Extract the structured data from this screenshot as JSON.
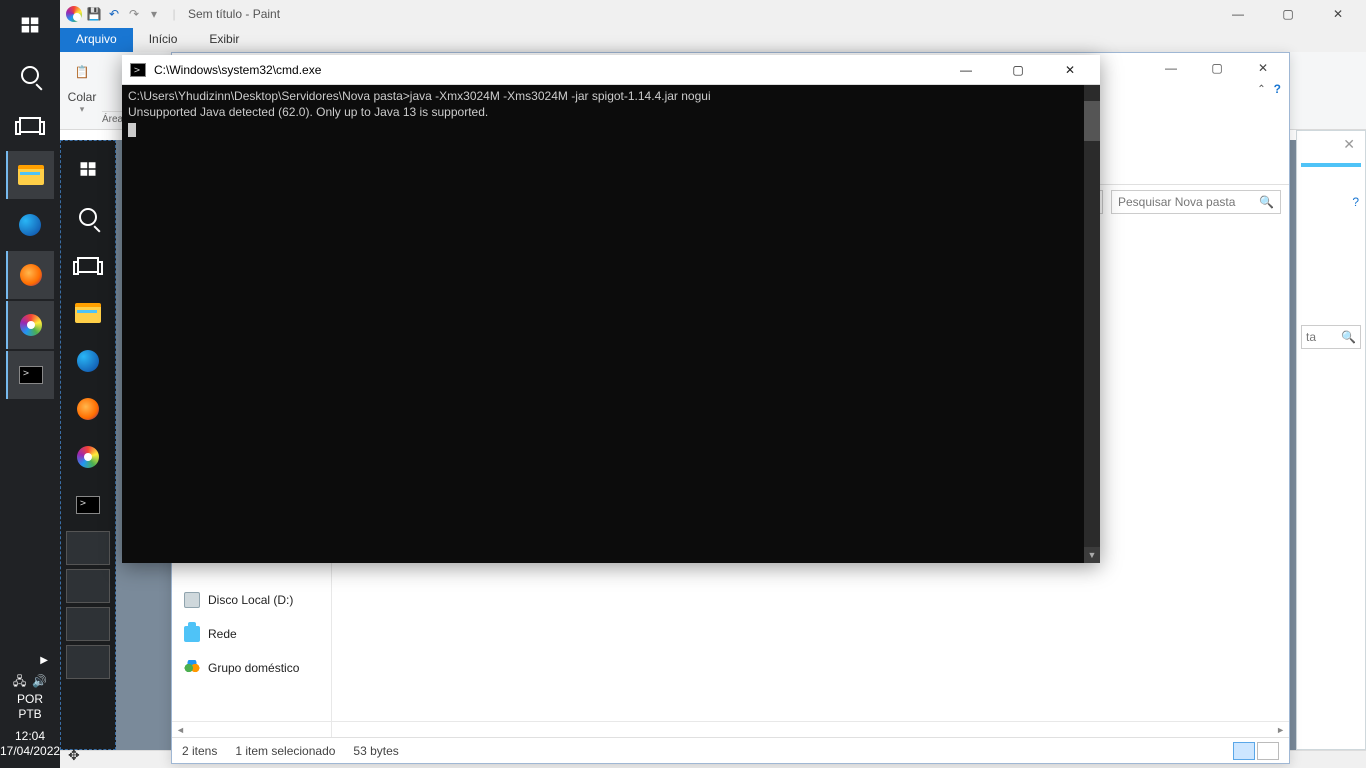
{
  "taskbar": {
    "lang_line1": "POR",
    "lang_line2": "PTB",
    "clock_time": "12:04",
    "clock_date": "17/04/2022"
  },
  "paint": {
    "title": "Sem título - Paint",
    "tab_file": "Arquivo",
    "tab_home": "Início",
    "tab_view": "Exibir",
    "paste_label": "Colar",
    "group_clipboard": "Área de Transferência"
  },
  "explorer": {
    "search_placeholder": "Pesquisar Nova pasta",
    "nav_disk": "Disco Local (D:)",
    "nav_network": "Rede",
    "nav_homegroup": "Grupo doméstico",
    "status_items": "2 itens",
    "status_selected": "1 item selecionado",
    "status_bytes": "53 bytes"
  },
  "explorer2": {
    "search_tail": "ta"
  },
  "cmd": {
    "title": "C:\\Windows\\system32\\cmd.exe",
    "line1": "C:\\Users\\Yhudizinn\\Desktop\\Servidores\\Nova pasta>java -Xmx3024M -Xms3024M -jar spigot-1.14.4.jar nogui",
    "line2": "Unsupported Java detected (62.0). Only up to Java 13 is supported."
  }
}
